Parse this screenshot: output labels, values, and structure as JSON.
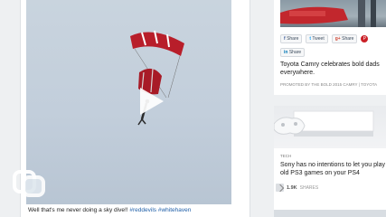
{
  "post": {
    "caption_text": "Well that's me never doing a sky dive!! ",
    "hashtags": [
      "#reddevils",
      "#whitehaven"
    ]
  },
  "sidebar": {
    "card1": {
      "share_buttons": [
        {
          "icon": "f",
          "label": "Share"
        },
        {
          "icon": "t",
          "label": "Tweet"
        },
        {
          "icon": "g+",
          "label": "Share"
        }
      ],
      "pin_icon": "P",
      "linkedin": {
        "icon": "in",
        "label": "Share"
      },
      "headline": "Toyota Camry celebrates bold dads everywhere.",
      "promoted": "PROMOTED BY THE BOLD 2015 CAMRY | TOYOTA"
    },
    "card2": {
      "tag": "TECH",
      "headline": "Sony has no intentions to let you play old PS3 games on your PS4",
      "share_count": "1.9K",
      "share_label": "SHARES"
    }
  }
}
